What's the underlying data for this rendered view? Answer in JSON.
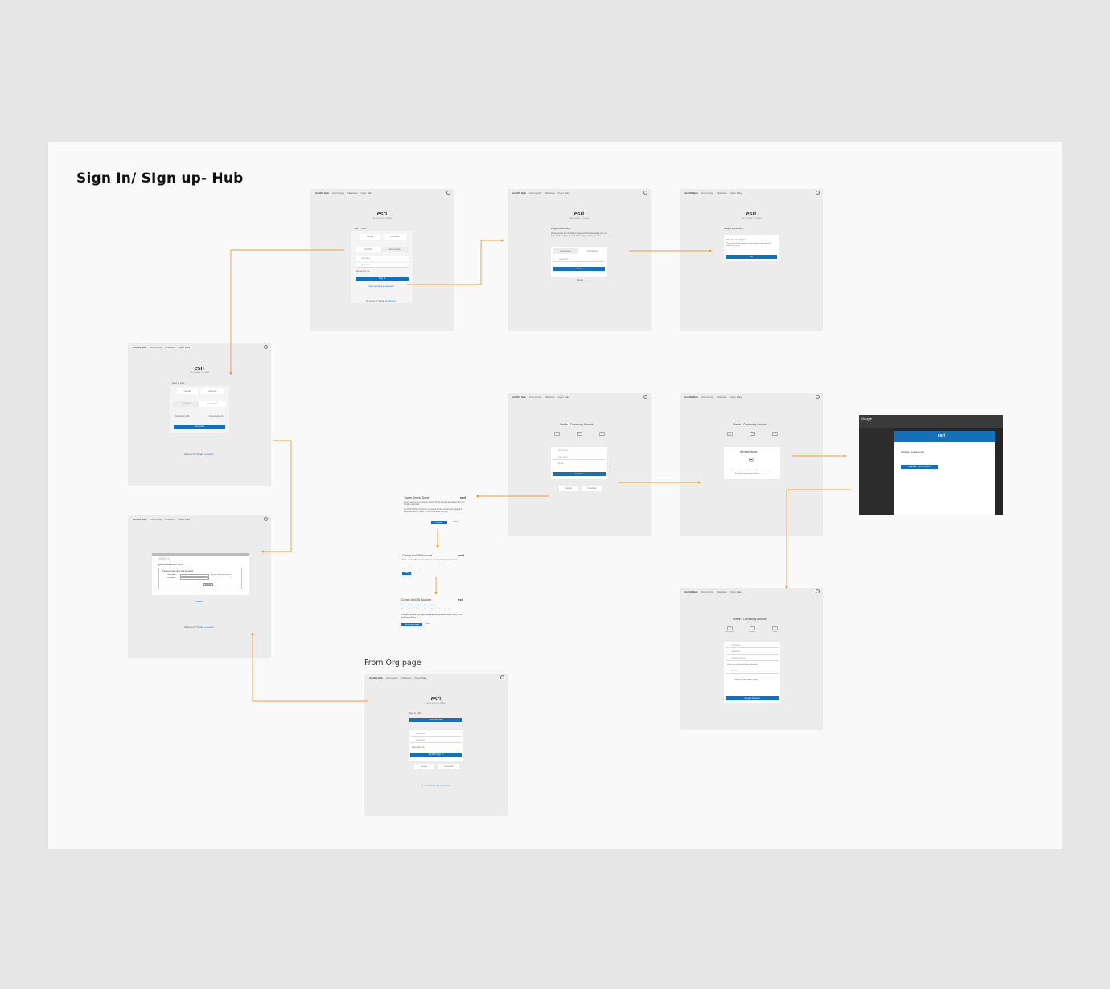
{
  "board": {
    "title": "Sign In/ SIgn up- Hub",
    "subtitle": "From Org page"
  },
  "nav": {
    "brand": "ArcGIS Hub",
    "links": [
      "Community",
      "Initiatives",
      "Open Data"
    ]
  },
  "signin": {
    "logo": "esri",
    "logo_sub": "THE SCIENCE OF WHERE",
    "sign_in_with": "Sign in with",
    "google": "Google",
    "facebook": "Facebook",
    "tab_arcgis": "ArcGIS",
    "tab_enterprise": "Enterprise",
    "username": "username",
    "password": "password",
    "remember": "Remember me",
    "sign_in_button": "Sign In",
    "forgot": "Forgot username or password?",
    "no_account": "No account?",
    "create_account": "Create an account"
  },
  "forgot": {
    "title": "Forgot something?",
    "body": "Please provide the information requested below associated with your login. We'll send you an email with a way to retrieve the issue.",
    "tab_username": "Username",
    "tab_password": "Password",
    "field": "password",
    "send_button": "Send",
    "cancel": "Cancel"
  },
  "check_email": {
    "title": "Forgot something?",
    "heading": "Check your Email",
    "body": "Please check your email for a message that will help you resolve the issue.",
    "ok_button": "OK"
  },
  "enterprise": {
    "org_url": "Organization URL",
    "org_value": ".maps.arcgis.com",
    "continue_button": "Continue"
  },
  "enterprise_login": {
    "sign_in": "Sign In",
    "domain": "partneraws.esri.com",
    "prompt": "Type your user name and password",
    "user_name": "User name:",
    "password": "Password:",
    "example": "Example: domain\\username",
    "button": "Sign in",
    "cancel": "Cancel"
  },
  "create_account": {
    "title": "Create a Community Account",
    "steps": [
      "Information",
      "Confirm",
      "Create"
    ],
    "first_name": "First name",
    "last_name": "Last name",
    "email": "Email",
    "continue_button": "Continue",
    "almost_done": "Almost done...",
    "sent_line": "We've sent an email to",
    "sent_email": "johndoe@example.com",
    "finish_line": "to finish creating your account.",
    "username": "username",
    "password": "password",
    "repeat_password": "repeat password",
    "security_question": "Select security question (for password)",
    "answer": "Answer",
    "terms": "Terms of Use and Privacy Policy",
    "create_button": "Create Account"
  },
  "almost_done_dialog": {
    "title": "You're Almost Done",
    "logo": "esri",
    "body": "We just need you to create an ArcGIS Public Account associated with your Google credentials.",
    "body2": "An ArcGIS Public Account is a personal account with limited usage and capabilities and is meant for non commercial use only.",
    "primary": "Continue",
    "secondary": "Cancel"
  },
  "arcgis_account_dialog": {
    "title": "Create ArcGIS Account",
    "logo": "esri",
    "body": "We've created this username for you. You can change it if you want.",
    "primary": "Next",
    "secondary": "Cancel"
  },
  "arcgis_terms_dialog": {
    "title": "Create ArcGIS Account",
    "logo": "esri",
    "review": "Review the Terms of Use and Privacy Policy",
    "review2": "Review the Terms of Use and Privacy Policy in other languages",
    "agree": "I accept and agree to be legally bound by the Esri ArcGIS Online Terms of Use and Privacy Policy",
    "primary": "Create my account",
    "secondary": "Cancel"
  },
  "org_signin": {
    "org_button": "ARCGIS ORG",
    "arcgis_sign_in": "ArcGIS Sign In"
  },
  "email_screenshot": {
    "app": "Google",
    "esri": "esri",
    "subject": "Activate Your Account",
    "button": "Activate Your Account"
  },
  "colors": {
    "accent": "#1470b8",
    "arrow": "#f0a030",
    "board": "#f9f9f9",
    "background": "#e6e6e6",
    "screen": "#ececec"
  }
}
